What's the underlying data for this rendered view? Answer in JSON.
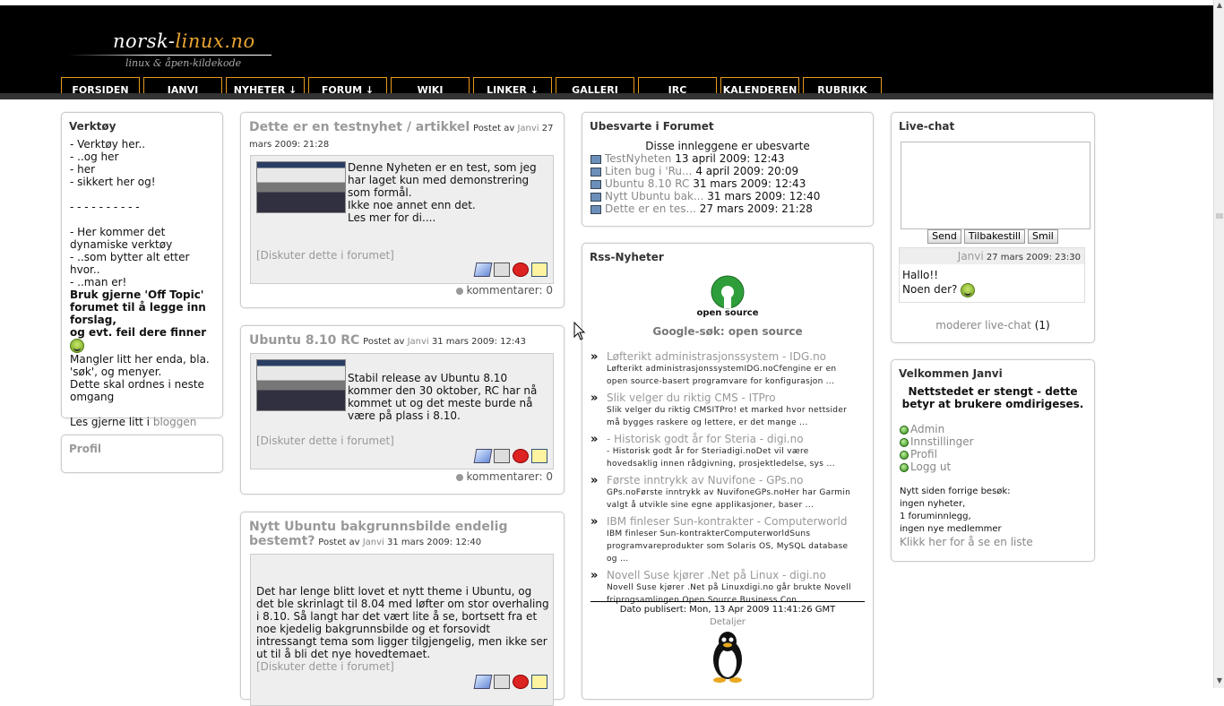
{
  "header": {
    "logo_part1": "norsk-",
    "logo_part2": "linux.no",
    "logo_sub": "linux & åpen-kildekode"
  },
  "nav": [
    {
      "label": "FORSIDEN"
    },
    {
      "label": "JANVI"
    },
    {
      "label": "NYHETER ↓"
    },
    {
      "label": "FORUM ↓"
    },
    {
      "label": "WIKI"
    },
    {
      "label": "LINKER ↓"
    },
    {
      "label": "GALLERI"
    },
    {
      "label": "IRC"
    },
    {
      "label": "KALENDEREN"
    },
    {
      "label": "RUBRIKK"
    }
  ],
  "tools": {
    "title": "Verktøy",
    "lines": [
      "- Verktøy her..",
      "- ..og her",
      "- her",
      "- sikkert her og!",
      "- - - - - - - - - -",
      "- Her kommer det dynamiske verktøy",
      "- ..som bytter alt etter hvor..",
      "- ..man er!"
    ],
    "bold1": "Bruk gjerne 'Off Topic' forumet til å legge inn forslag,",
    "bold2": "og evt. feil dere finner",
    "missing": "Mangler litt her enda, bla. 'søk', og menyer.",
    "fix": "Dette skal ordnes i neste omgang",
    "read": "Les gjerne litt i ",
    "blog_link": "bloggen"
  },
  "profile": {
    "title": "Profil"
  },
  "news": [
    {
      "title": "Dette er en testnyhet / artikkel",
      "posted_by": "Postet av",
      "author": "Janvi",
      "date": "27 mars 2009: 21:28",
      "text": "Denne Nyheten er en test, som jeg har laget kun med demonstrering som formål.\nIkke noe annet enn det.\nLes mer for di....",
      "discuss": "[Diskuter dette i forumet]",
      "comments": "kommentarer: 0"
    },
    {
      "title": "Ubuntu 8.10 RC",
      "posted_by": "Postet av",
      "author": "Janvi",
      "date": "31 mars 2009: 12:43",
      "text": "Stabil release av Ubuntu 8.10 kommer den 30 oktober, RC har nå kommet ut og det meste burde nå være på plass i 8.10.",
      "discuss": "[Diskuter dette i forumet]",
      "comments": "kommentarer: 0"
    },
    {
      "title": "Nytt Ubuntu bakgrunnsbilde endelig bestemt?",
      "posted_by": "Postet av",
      "author": "Janvi",
      "date": "31 mars 2009: 12:40",
      "text": "Det har lenge blitt lovet et nytt theme i Ubuntu, og det ble skrinlagt til 8.04 med løfter om stor overhaling i 8.10. Så langt har det vært lite å se, bortsett fra et noe kjedelig bakgrunnsbilde og et forsovidt intressangt tema som ligger tilgjengelig, men ikke ser ut til å bli det nye hovedtemaet.",
      "discuss": "[Diskuter dette i forumet]"
    }
  ],
  "forum": {
    "title": "Ubesvarte i Forumet",
    "subtitle": "Disse innleggene er ubesvarte",
    "items": [
      {
        "link": "TestNyheten",
        "date": "13 april 2009: 12:43"
      },
      {
        "link": "Liten bug i 'Ru...",
        "date": "4 april 2009: 20:09"
      },
      {
        "link": "Ubuntu 8.10 RC",
        "date": "31 mars 2009: 12:43"
      },
      {
        "link": "Nytt Ubuntu bak...",
        "date": "31 mars 2009: 12:40"
      },
      {
        "link": "Dette er en tes...",
        "date": "27 mars 2009: 21:28"
      }
    ]
  },
  "rss": {
    "title": "Rss-Nyheter",
    "logo_text": "open source",
    "feed_title": "Google-søk: open source",
    "items": [
      {
        "link": "Løfterikt administrasjonssystem - IDG.no",
        "desc": "Løfterikt administrasjonssystemIDG.noCfengine er en open source-basert programvare for konfigurasjon ..."
      },
      {
        "link": "Slik velger du riktig CMS - ITPro",
        "desc": "Slik velger du riktig CMSITPro! et marked hvor nettsider må bygges raskere og lettere, er det mange ..."
      },
      {
        "link": "- Historisk godt år for Steria - digi.no",
        "desc": "- Historisk godt år for Steriadigi.noDet vil være hovedsaklig innen rådgivning, prosjektledelse, sys ..."
      },
      {
        "link": "Første inntrykk av Nuvifone - GPs.no",
        "desc": "GPs.noFørste inntrykk av NuvifoneGPs.noHer har Garmin valgt å utvikle sine egne applikasjoner, baser ..."
      },
      {
        "link": "IBM finleser Sun-kontrakter - Computerworld",
        "desc": "IBM finleser Sun-kontrakterComputerworldSuns programvareprodukter som Solaris OS, MySQL database og ..."
      },
      {
        "link": "Novell Suse kjører .Net på Linux - digi.no",
        "desc": "Novell Suse kjører .Net på Linuxdigi.no går brukte Novell friprogsamlingen Open Source Business Con ..."
      }
    ],
    "published": "Dato publisert: Mon, 13 Apr 2009 11:41:26 GMT",
    "details": "Detaljer"
  },
  "livechat": {
    "title": "Live-chat",
    "send": "Send",
    "reset": "Tilbakestill",
    "smile": "Smil",
    "msg_author": "Janvi",
    "msg_date": "27 mars 2009: 23:30",
    "msg_line1": "Hallo!!",
    "msg_line2": "Noen der?",
    "moderate": "moderer live-chat",
    "moderate_count": "(1)"
  },
  "welcome": {
    "title": "Velkommen Janvi",
    "closed": "Nettstedet er stengt - dette betyr at brukere omdirigeses.",
    "links": [
      "Admin",
      "Innstillinger",
      "Profil",
      "Logg ut"
    ],
    "since": "Nytt siden forrige besøk:",
    "line1": "ingen nyheter,",
    "line2": "1 foruminnlegg,",
    "line3": "ingen nye medlemmer",
    "list_link": "Klikk her for å se en liste"
  }
}
